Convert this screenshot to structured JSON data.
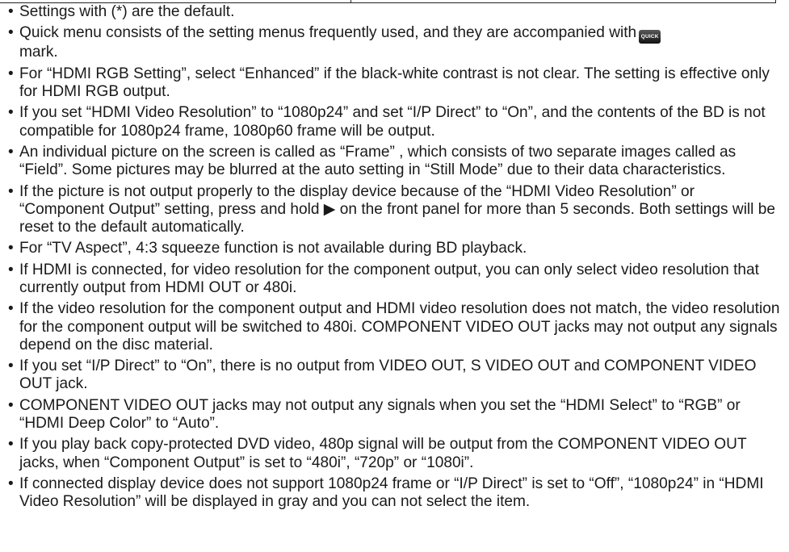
{
  "notes": [
    "Settings with (*) are the default.",
    {
      "text_before": "Quick menu consists of the setting menus frequently used, and they are accompanied with",
      "badge": "QUICK",
      "badge_icon": "quick-badge-icon",
      "text_after": "mark."
    },
    "For “HDMI RGB Setting”, select “Enhanced” if the black-white contrast is not clear. The setting is effective only for HDMI RGB output.",
    "If you set “HDMI Video Resolution” to “1080p24” and set “I/P Direct” to “On”, and the contents of the BD is not compatible for 1080p24 frame, 1080p60 frame will be output.",
    "An individual picture on the screen is called as “Frame” , which consists of two separate images called as “Field”. Some pictures may be blurred at the auto setting in “Still Mode” due to their data characteristics.",
    "If the picture is not output properly to the display device because of the “HDMI Video Resolution” or “Component Output” setting, press and hold ▶ on the front panel for more than 5 seconds. Both settings will be reset to the default automatically.",
    "For “TV Aspect”, 4:3 squeeze function is not available during BD playback.",
    "If HDMI is connected, for video resolution for the component output, you can only select video resolution that currently output from HDMI OUT or 480i.",
    "If the video resolution for the component output and HDMI video resolution does not match, the video resolution for the component output will be switched to 480i. COMPONENT VIDEO OUT jacks may not output any signals depend on the disc material.",
    "If you set “I/P Direct” to “On”, there is no output from VIDEO OUT, S VIDEO OUT and COMPONENT VIDEO OUT jack.",
    "COMPONENT VIDEO OUT jacks may not output any signals when you set the “HDMI Select” to “RGB” or “HDMI Deep Color” to “Auto”.",
    "If you play back copy-protected DVD video, 480p signal will be output from the COMPONENT VIDEO OUT jacks, when “Component Output” is set to “480i”, “720p” or “1080i”.",
    "If connected display device does not support 1080p24 frame or “I/P Direct” is set to “Off”, “1080p24” in “HDMI Video Resolution” will be displayed in gray and you can not select the item."
  ]
}
